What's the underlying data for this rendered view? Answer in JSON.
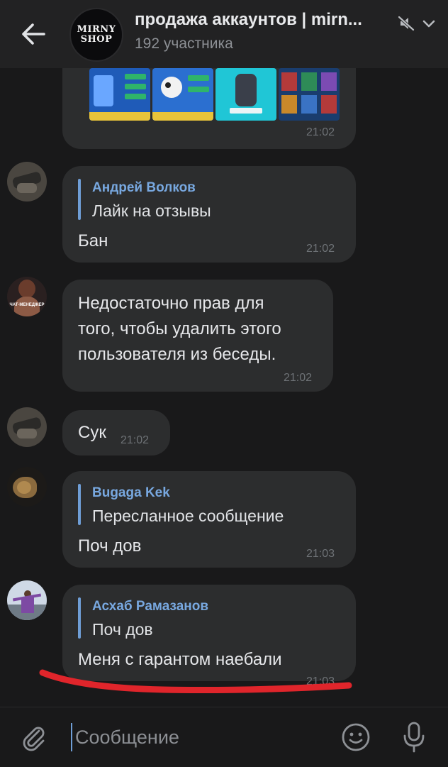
{
  "header": {
    "title": "продажа аккаунтов | mirn...",
    "subtitle": "192 участника",
    "avatar_text_line1": "MIRNY",
    "avatar_text_line2": "SHOP"
  },
  "messages": [
    {
      "type": "photos",
      "time": "21:02"
    },
    {
      "quote_name": "Андрей Волков",
      "quote_text": "Лайк на отзывы",
      "text": "Бан",
      "time": "21:02"
    },
    {
      "text_lines": [
        "Недостаточно прав для",
        "того, чтобы удалить этого",
        "пользователя из беседы."
      ],
      "time": "21:02",
      "avatar_label": "ЧАТ-МЕНЕДЖЕР"
    },
    {
      "text": "Сук",
      "time": "21:02"
    },
    {
      "quote_name": "Bugaga Kek",
      "quote_text": "Пересланное сообщение",
      "text": "Поч дов",
      "time": "21:03"
    },
    {
      "quote_name": "Асхаб Рамазанов",
      "quote_text": "Поч дов",
      "text": "Меня с гарантом наебали",
      "time": "21:03"
    }
  ],
  "composer": {
    "placeholder": "Сообщение"
  },
  "icons": {
    "back": "arrow-left-icon",
    "mute": "bell-muted-icon",
    "dropdown": "chevron-down-icon",
    "attach": "paperclip-icon",
    "emoji": "smile-icon",
    "mic": "microphone-icon"
  },
  "colors": {
    "background": "#19191a",
    "bubble": "#2c2d2e",
    "accent": "#6f9ed6",
    "annotation": "#e0252b"
  }
}
